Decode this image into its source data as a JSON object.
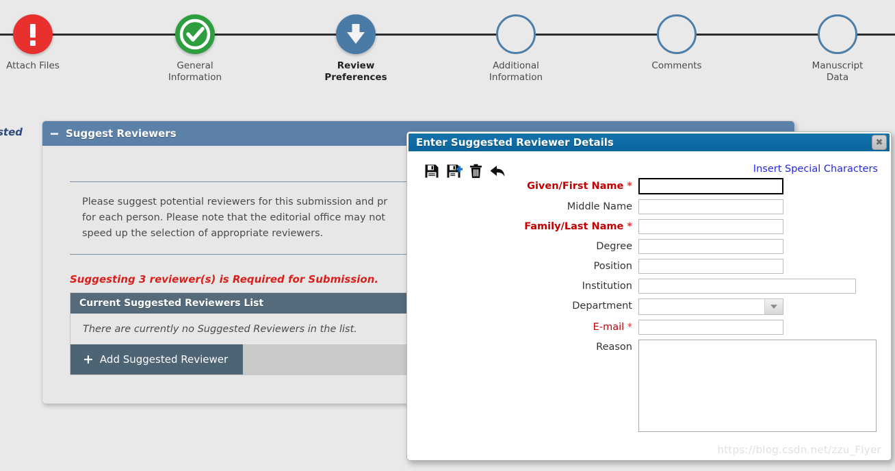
{
  "stepper": {
    "steps": [
      {
        "label": "Attach Files",
        "icon": "exclamation-circle-icon",
        "state": "error",
        "current": false
      },
      {
        "label": "General\nInformation",
        "icon": "check-circle-icon",
        "state": "complete",
        "current": false
      },
      {
        "label": "Review\nPreferences",
        "icon": "arrow-down-circle-icon",
        "state": "current",
        "current": true
      },
      {
        "label": "Additional\nInformation",
        "icon": "empty-circle-icon",
        "state": "pending",
        "current": false
      },
      {
        "label": "Comments",
        "icon": "empty-circle-icon",
        "state": "pending",
        "current": false
      },
      {
        "label": "Manuscript\nData",
        "icon": "empty-circle-icon",
        "state": "pending",
        "current": false
      }
    ],
    "colors": {
      "error": "#e8302e",
      "complete": "#2e9e3e",
      "current": "#4a7ba7",
      "pending_outline": "#4d7ea8",
      "line": "#2b2b2b"
    }
  },
  "left_cut_text": "sted",
  "panel": {
    "title": "Suggest Reviewers",
    "collapse_icon": "minus-icon",
    "description": "Please suggest potential reviewers for this submission and pr\nfor each person. Please note that the editorial office may not\nspeed up the selection of appropriate reviewers.",
    "required_note": "Suggesting 3 reviewer(s) is Required for Submission.",
    "list": {
      "header": "Current Suggested Reviewers List",
      "empty_message": "There are currently no Suggested Reviewers in the list.",
      "add_button_label": "Add Suggested Reviewer",
      "add_button_icon": "plus-icon"
    },
    "header_color": "#5c81a8",
    "list_header_color": "#556b7b"
  },
  "dialog": {
    "title": "Enter Suggested Reviewer Details",
    "close_icon": "close-icon",
    "titlebar_color": "#0d6ba5",
    "toolbar": [
      {
        "name": "save-icon",
        "label": "Save"
      },
      {
        "name": "save-and-add-icon",
        "label": "Save and Add Another"
      },
      {
        "name": "trash-icon",
        "label": "Delete"
      },
      {
        "name": "back-arrow-icon",
        "label": "Back"
      }
    ],
    "special_chars_link": "Insert Special Characters",
    "fields": [
      {
        "label": "Given/First Name",
        "required": true,
        "value": "",
        "type": "text",
        "width": "w-std",
        "focused": true
      },
      {
        "label": "Middle Name",
        "required": false,
        "value": "",
        "type": "text",
        "width": "w-std",
        "focused": false
      },
      {
        "label": "Family/Last Name",
        "required": true,
        "value": "",
        "type": "text",
        "width": "w-std",
        "focused": false
      },
      {
        "label": "Degree",
        "required": false,
        "value": "",
        "type": "text",
        "width": "w-std",
        "focused": false
      },
      {
        "label": "Position",
        "required": false,
        "value": "",
        "type": "text",
        "width": "w-std",
        "focused": false
      },
      {
        "label": "Institution",
        "required": false,
        "value": "",
        "type": "text",
        "width": "w-wide",
        "focused": false
      },
      {
        "label": "Department",
        "required": false,
        "value": "",
        "type": "select",
        "width": "w-std",
        "focused": false
      },
      {
        "label": "E-mail",
        "required": true,
        "value": "",
        "type": "text",
        "width": "w-std",
        "focused": false
      },
      {
        "label": "Reason",
        "required": false,
        "value": "",
        "type": "textarea",
        "width": "w-area",
        "focused": false
      }
    ],
    "required_marker": "*"
  },
  "watermark": "https://blog.csdn.net/zzu_Flyer"
}
